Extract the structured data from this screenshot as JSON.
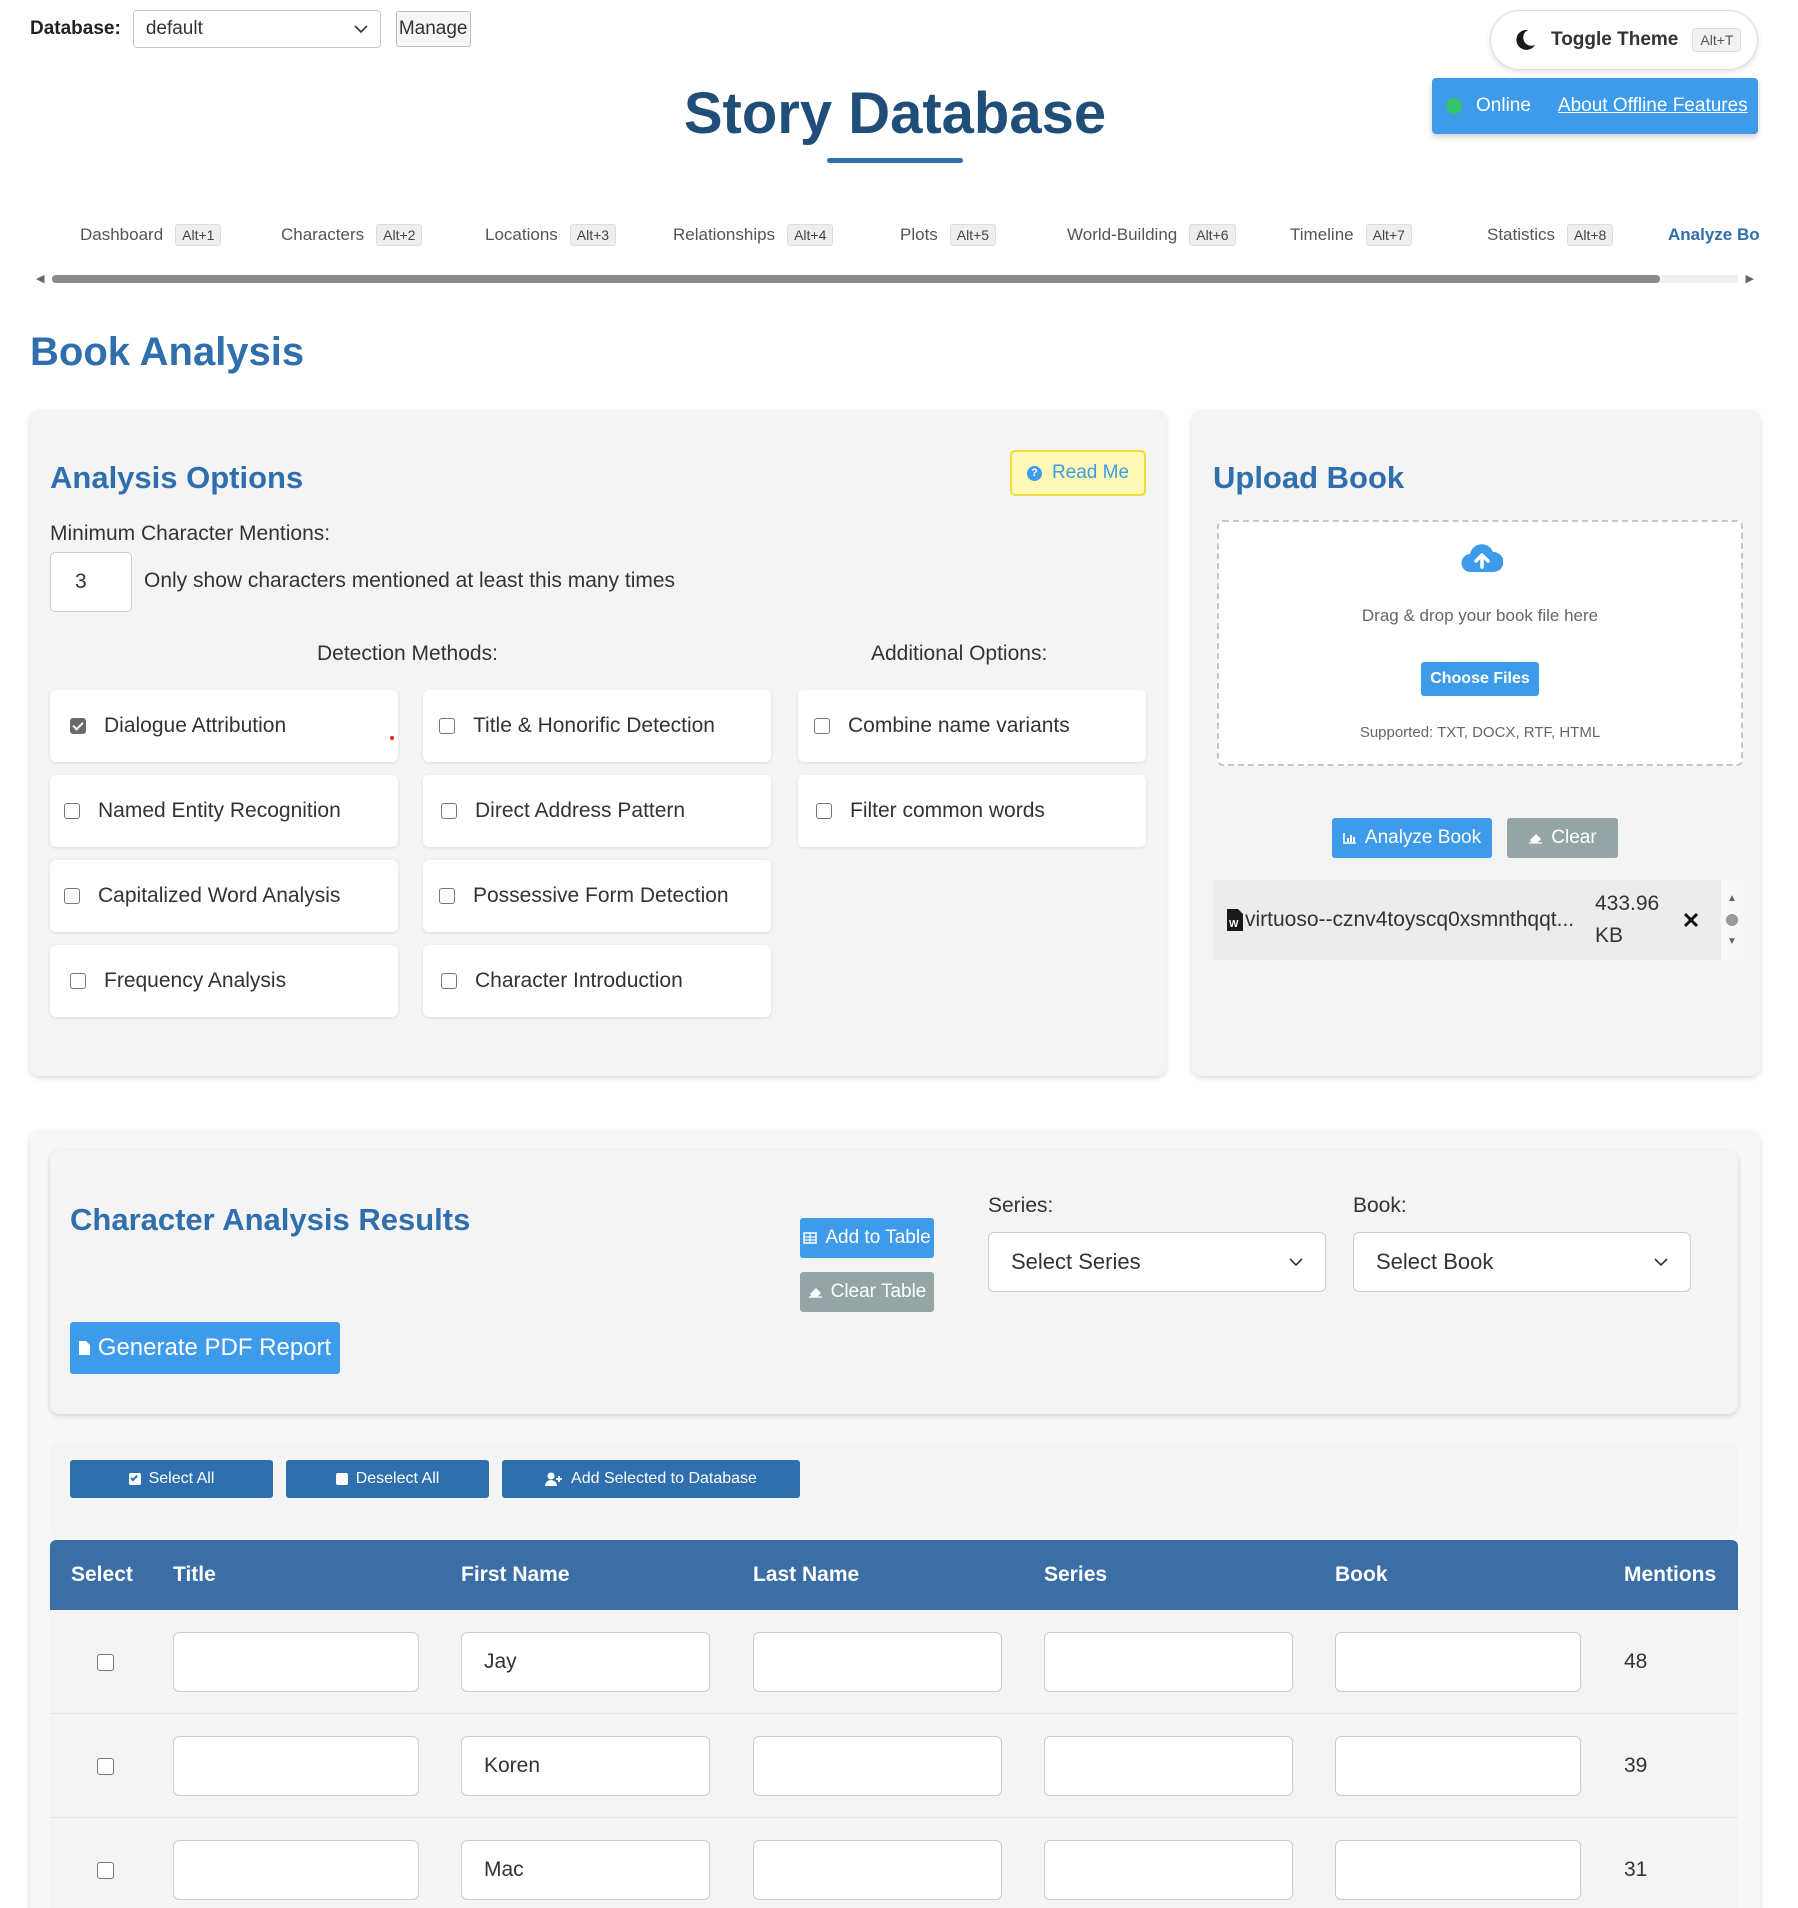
{
  "header": {
    "database_label": "Database:",
    "database_value": "default",
    "manage_label": "Manage",
    "theme_label": "Toggle Theme",
    "theme_shortcut": "Alt+T",
    "status": "Online",
    "offline_link": "About Offline Features",
    "title": "Story Database"
  },
  "nav": {
    "items": [
      {
        "label": "Dashboard",
        "shortcut": "Alt+1"
      },
      {
        "label": "Characters",
        "shortcut": "Alt+2"
      },
      {
        "label": "Locations",
        "shortcut": "Alt+3"
      },
      {
        "label": "Relationships",
        "shortcut": "Alt+4"
      },
      {
        "label": "Plots",
        "shortcut": "Alt+5"
      },
      {
        "label": "World-Building",
        "shortcut": "Alt+6"
      },
      {
        "label": "Timeline",
        "shortcut": "Alt+7"
      },
      {
        "label": "Statistics",
        "shortcut": "Alt+8"
      },
      {
        "label": "Analyze Bo"
      }
    ]
  },
  "page": {
    "title": "Book Analysis"
  },
  "analysis_options": {
    "title": "Analysis Options",
    "readme_label": "Read Me",
    "min_mentions_label": "Minimum Character Mentions:",
    "min_mentions_value": "3",
    "min_mentions_help": "Only show characters mentioned at least this many times",
    "detection_heading": "Detection Methods:",
    "additional_heading": "Additional Options:",
    "detection_methods": [
      {
        "label": "Dialogue Attribution",
        "checked": true
      },
      {
        "label": "Title & Honorific Detection",
        "checked": false
      },
      {
        "label": "Named Entity Recognition",
        "checked": false
      },
      {
        "label": "Direct Address Pattern",
        "checked": false
      },
      {
        "label": "Capitalized Word Analysis",
        "checked": false
      },
      {
        "label": "Possessive Form Detection",
        "checked": false
      },
      {
        "label": "Frequency Analysis",
        "checked": false
      },
      {
        "label": "Character Introduction",
        "checked": false
      }
    ],
    "additional_options": [
      {
        "label": "Combine name variants",
        "checked": false
      },
      {
        "label": "Filter common words",
        "checked": false
      }
    ]
  },
  "upload": {
    "title": "Upload Book",
    "drop_text": "Drag & drop your book file here",
    "choose_label": "Choose Files",
    "supported": "Supported: TXT, DOCX, RTF, HTML",
    "analyze_label": "Analyze Book",
    "clear_label": "Clear",
    "file_name": "virtuoso--cznv4toyscq0xsmnthqqt...",
    "file_size_value": "433.96",
    "file_size_unit": "KB"
  },
  "results": {
    "title": "Character Analysis Results",
    "add_to_table": "Add to Table",
    "clear_table": "Clear Table",
    "series_label": "Series:",
    "series_value": "Select Series",
    "book_label": "Book:",
    "book_value": "Select Book",
    "pdf_label": "Generate PDF Report",
    "select_all": "Select All",
    "deselect_all": "Deselect All",
    "add_selected": "Add Selected to Database"
  },
  "table": {
    "columns": [
      "Select",
      "Title",
      "First Name",
      "Last Name",
      "Series",
      "Book",
      "Mentions"
    ],
    "rows": [
      {
        "title": "",
        "first_name": "Jay",
        "last_name": "",
        "series": "",
        "book": "",
        "mentions": "48"
      },
      {
        "title": "",
        "first_name": "Koren",
        "last_name": "",
        "series": "",
        "book": "",
        "mentions": "39"
      },
      {
        "title": "",
        "first_name": "Mac",
        "last_name": "",
        "series": "",
        "book": "",
        "mentions": "31"
      }
    ]
  }
}
